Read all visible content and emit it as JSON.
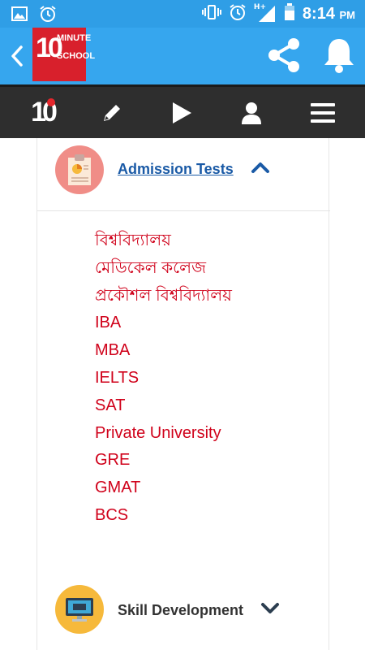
{
  "status_bar": {
    "time": "8:14",
    "ampm": "PM",
    "network_label": "H+",
    "left_icons": [
      "image-icon",
      "alarm-icon"
    ],
    "right_icons": [
      "vibrate-icon",
      "alarm-icon",
      "signal-icon",
      "battery-icon"
    ]
  },
  "app_bar": {
    "logo": {
      "number": "10",
      "line1": "MINUTE",
      "line2": "SCHOOL"
    },
    "icons": [
      "back-arrow-icon",
      "share-icon",
      "bell-icon"
    ]
  },
  "nav_bar": {
    "logo_text": "10",
    "icons": [
      "pencil-icon",
      "play-icon",
      "user-icon",
      "menu-icon"
    ]
  },
  "categories": [
    {
      "title": "Admission Tests",
      "expanded": true,
      "icon": "clipboard-chart-icon",
      "icon_bg": "#f08d87",
      "items": [
        "বিশ্ববিদ্যালয়",
        "মেডিকেল কলেজ",
        "প্রকৌশল বিশ্ববিদ্যালয়",
        "IBA",
        "MBA",
        "IELTS",
        "SAT",
        "Private University",
        "GRE",
        "GMAT",
        "BCS"
      ]
    },
    {
      "title": "Skill Development",
      "expanded": false,
      "icon": "monitor-icon",
      "icon_bg": "#f6b93b"
    }
  ],
  "colors": {
    "status_bar": "#2f9ee6",
    "app_bar": "#36a6ee",
    "nav_bar": "#2e2e2e",
    "link": "#1a5aa6",
    "item_text": "#d0021b",
    "logo_red": "#d8202c"
  }
}
